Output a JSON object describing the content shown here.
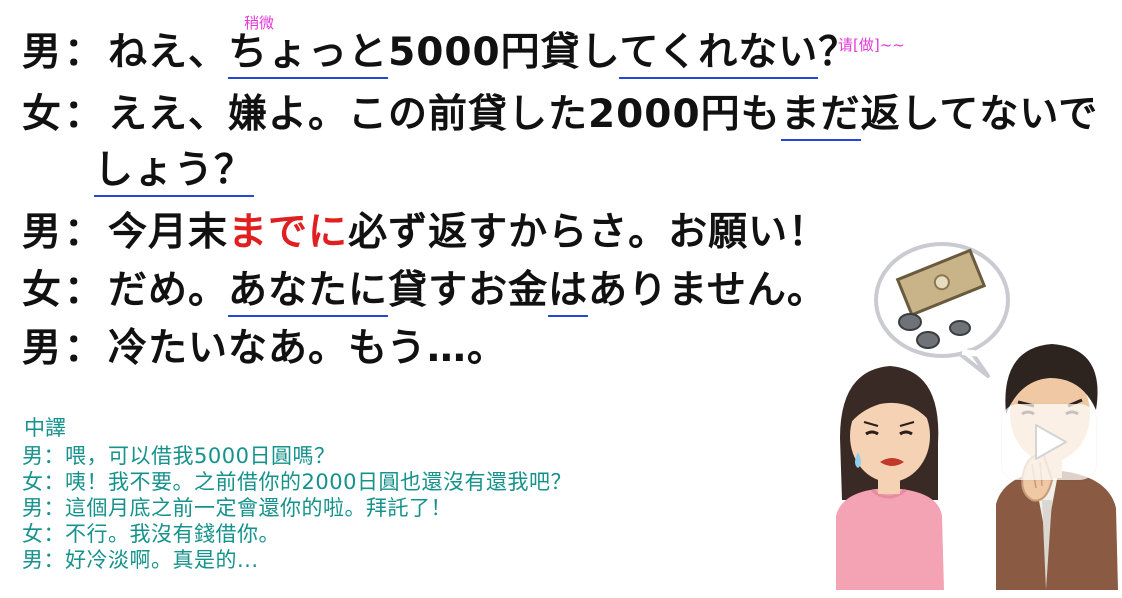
{
  "dialogue": [
    {
      "speaker": "男",
      "colon": "：",
      "parts": [
        {
          "text": "ねえ、",
          "style": ""
        },
        {
          "text": "ちょっと",
          "style": "u"
        },
        {
          "text": "5000円貸し",
          "style": ""
        },
        {
          "text": "てくれない",
          "style": "u"
        },
        {
          "text": "？",
          "style": ""
        }
      ]
    },
    {
      "speaker": "女",
      "colon": "：",
      "parts": [
        {
          "text": "ええ、嫌よ。この前貸した2000円も",
          "style": ""
        },
        {
          "text": "まだ",
          "style": "u"
        },
        {
          "text": "返してないで",
          "style": ""
        }
      ]
    },
    {
      "speaker": "",
      "colon": "",
      "parts": [
        {
          "text": "しょう？",
          "style": "u"
        }
      ]
    },
    {
      "speaker": "男",
      "colon": "：",
      "parts": [
        {
          "text": "今月末",
          "style": ""
        },
        {
          "text": "までに",
          "style": "red"
        },
        {
          "text": "必ず返すからさ。お願い！",
          "style": ""
        }
      ]
    },
    {
      "speaker": "女",
      "colon": "：",
      "parts": [
        {
          "text": "だめ。",
          "style": ""
        },
        {
          "text": "あなたに",
          "style": "u"
        },
        {
          "text": "貸すお金",
          "style": ""
        },
        {
          "text": "は",
          "style": "u"
        },
        {
          "text": "ありません。",
          "style": ""
        }
      ]
    },
    {
      "speaker": "男",
      "colon": "：",
      "parts": [
        {
          "text": "冷たいなあ。もう…。",
          "style": ""
        }
      ]
    }
  ],
  "annotations": {
    "chotto": "稍微",
    "kurenai": "请[做]~~"
  },
  "translation": {
    "title": "中譯",
    "lines": [
      "男：喂，可以借我5000日圓嗎？",
      "女：咦！我不要。之前借你的2000日圓也還沒有還我吧？",
      "男：這個月底之前一定會還你的啦。拜託了！",
      "女：不行。我沒有錢借你。",
      "男：好冷淡啊。真是的..."
    ]
  },
  "colors": {
    "underline": "#2447d8",
    "emphasis": "#e02020",
    "annotation": "#e23ad8",
    "translation": "#16928c"
  },
  "icons": {
    "illustration": "money-lending-illustration",
    "play": "play-icon"
  }
}
